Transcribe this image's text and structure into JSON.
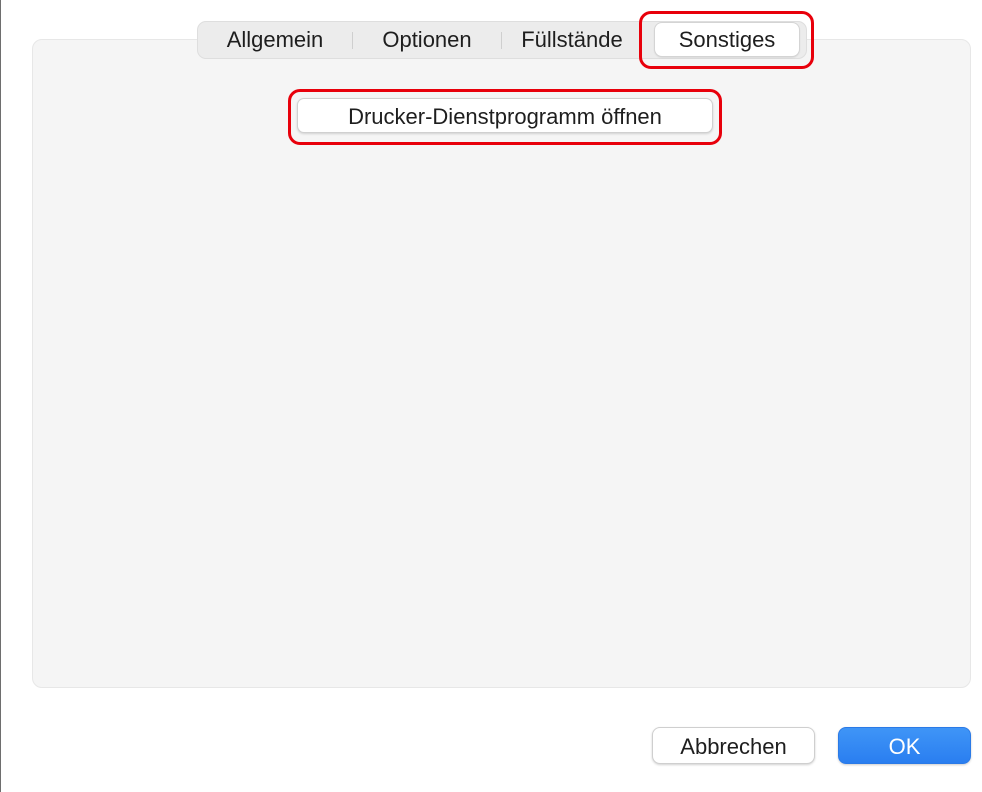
{
  "tabs": [
    {
      "label": "Allgemein",
      "selected": false
    },
    {
      "label": "Optionen",
      "selected": false
    },
    {
      "label": "Füllstände",
      "selected": false
    },
    {
      "label": "Sonstiges",
      "selected": true
    }
  ],
  "main": {
    "open_utility_label": "Drucker-Dienstprogramm öffnen"
  },
  "footer": {
    "cancel_label": "Abbrechen",
    "ok_label": "OK"
  },
  "colors": {
    "accent": "#2a7ef0",
    "highlight": "#e8000b",
    "panel_background": "#f5f5f5"
  }
}
